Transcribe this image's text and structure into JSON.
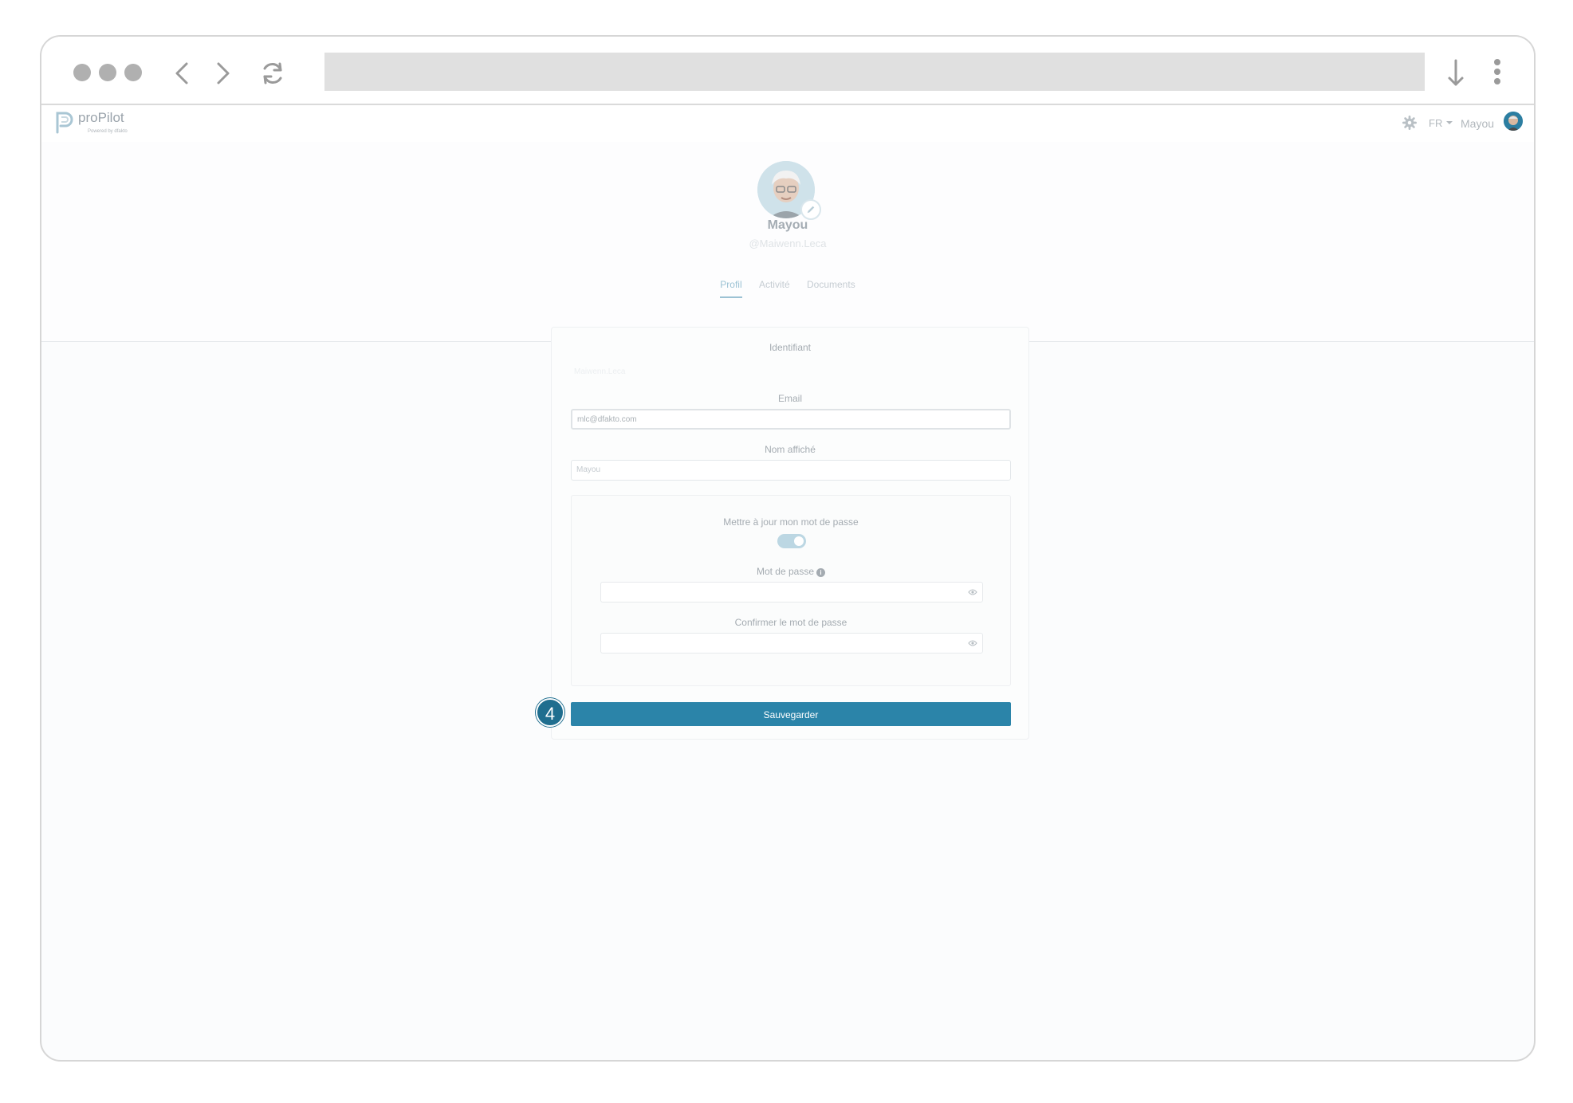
{
  "app": {
    "name": "proPilot",
    "powered_by": "Powered by dfakto"
  },
  "topbar": {
    "language": "FR",
    "user": "Mayou"
  },
  "profile": {
    "display_name": "Mayou",
    "handle": "@Maiwenn.Leca",
    "tabs": [
      {
        "label": "Profil",
        "active": true
      },
      {
        "label": "Activité",
        "active": false
      },
      {
        "label": "Documents",
        "active": false
      }
    ]
  },
  "form": {
    "identifiant_label": "Identifiant",
    "identifiant_value": "Maiwenn.Leca",
    "email_label": "Email",
    "email_value": "mlc@dfakto.com",
    "display_name_label": "Nom affiché",
    "display_name_value": "Mayou",
    "update_password_label": "Mettre à jour mon mot de passe",
    "update_password_enabled": true,
    "password_label": "Mot de passe",
    "confirm_password_label": "Confirmer le mot de passe",
    "save_label": "Sauvegarder"
  },
  "annotation": {
    "step_number": "4"
  },
  "colors": {
    "accent": "#2b84a9",
    "badge": "#1f6e8f"
  }
}
